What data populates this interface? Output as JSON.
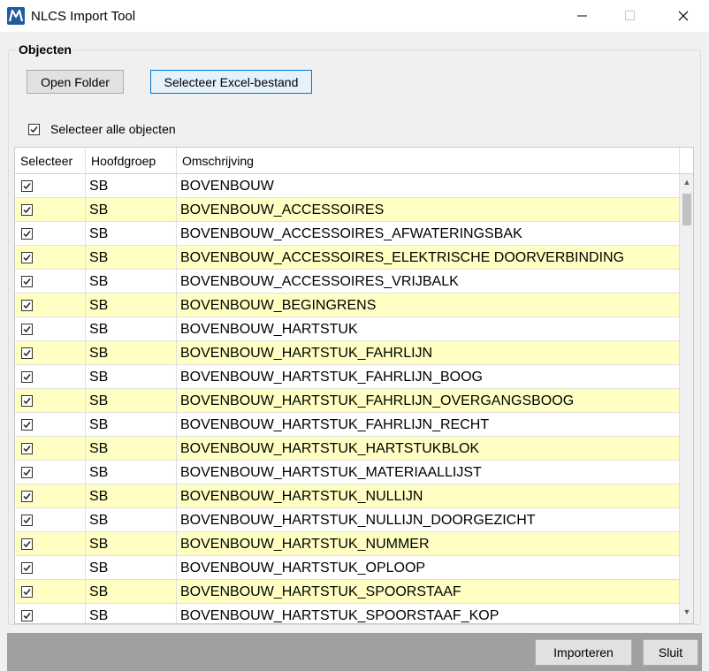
{
  "window": {
    "title": "NLCS Import Tool",
    "minimize_glyph": "—",
    "maximize_glyph": "☐",
    "close_glyph": "✕"
  },
  "group": {
    "label": "Objecten",
    "open_folder_label": "Open Folder",
    "select_excel_label": "Selecteer Excel-bestand",
    "select_all_label": "Selecteer alle objecten",
    "select_all_checked": true
  },
  "grid": {
    "columns": [
      "Selecteer",
      "Hoofdgroep",
      "Omschrijving"
    ],
    "rows": [
      {
        "checked": true,
        "group": "SB",
        "description": "BOVENBOUW"
      },
      {
        "checked": true,
        "group": "SB",
        "description": "BOVENBOUW_ACCESSOIRES"
      },
      {
        "checked": true,
        "group": "SB",
        "description": "BOVENBOUW_ACCESSOIRES_AFWATERINGSBAK"
      },
      {
        "checked": true,
        "group": "SB",
        "description": "BOVENBOUW_ACCESSOIRES_ELEKTRISCHE DOORVERBINDING"
      },
      {
        "checked": true,
        "group": "SB",
        "description": "BOVENBOUW_ACCESSOIRES_VRIJBALK"
      },
      {
        "checked": true,
        "group": "SB",
        "description": "BOVENBOUW_BEGINGRENS"
      },
      {
        "checked": true,
        "group": "SB",
        "description": "BOVENBOUW_HARTSTUK"
      },
      {
        "checked": true,
        "group": "SB",
        "description": "BOVENBOUW_HARTSTUK_FAHRLIJN"
      },
      {
        "checked": true,
        "group": "SB",
        "description": "BOVENBOUW_HARTSTUK_FAHRLIJN_BOOG"
      },
      {
        "checked": true,
        "group": "SB",
        "description": "BOVENBOUW_HARTSTUK_FAHRLIJN_OVERGANGSBOOG"
      },
      {
        "checked": true,
        "group": "SB",
        "description": "BOVENBOUW_HARTSTUK_FAHRLIJN_RECHT"
      },
      {
        "checked": true,
        "group": "SB",
        "description": "BOVENBOUW_HARTSTUK_HARTSTUKBLOK"
      },
      {
        "checked": true,
        "group": "SB",
        "description": "BOVENBOUW_HARTSTUK_MATERIAALLIJST"
      },
      {
        "checked": true,
        "group": "SB",
        "description": "BOVENBOUW_HARTSTUK_NULLIJN"
      },
      {
        "checked": true,
        "group": "SB",
        "description": "BOVENBOUW_HARTSTUK_NULLIJN_DOORGEZICHT"
      },
      {
        "checked": true,
        "group": "SB",
        "description": "BOVENBOUW_HARTSTUK_NUMMER"
      },
      {
        "checked": true,
        "group": "SB",
        "description": "BOVENBOUW_HARTSTUK_OPLOOP"
      },
      {
        "checked": true,
        "group": "SB",
        "description": "BOVENBOUW_HARTSTUK_SPOORSTAAF"
      },
      {
        "checked": true,
        "group": "SB",
        "description": "BOVENBOUW_HARTSTUK_SPOORSTAAF_KOP"
      }
    ],
    "alt_row_color": "#ffffc3"
  },
  "footer": {
    "import_label": "Importeren",
    "close_label": "Sluit"
  },
  "colors": {
    "accent": "#0078d7",
    "footer_bg": "#a0a0a0"
  },
  "icons": {
    "app": "microstation-logo-icon",
    "up": "▲",
    "down": "▼"
  }
}
